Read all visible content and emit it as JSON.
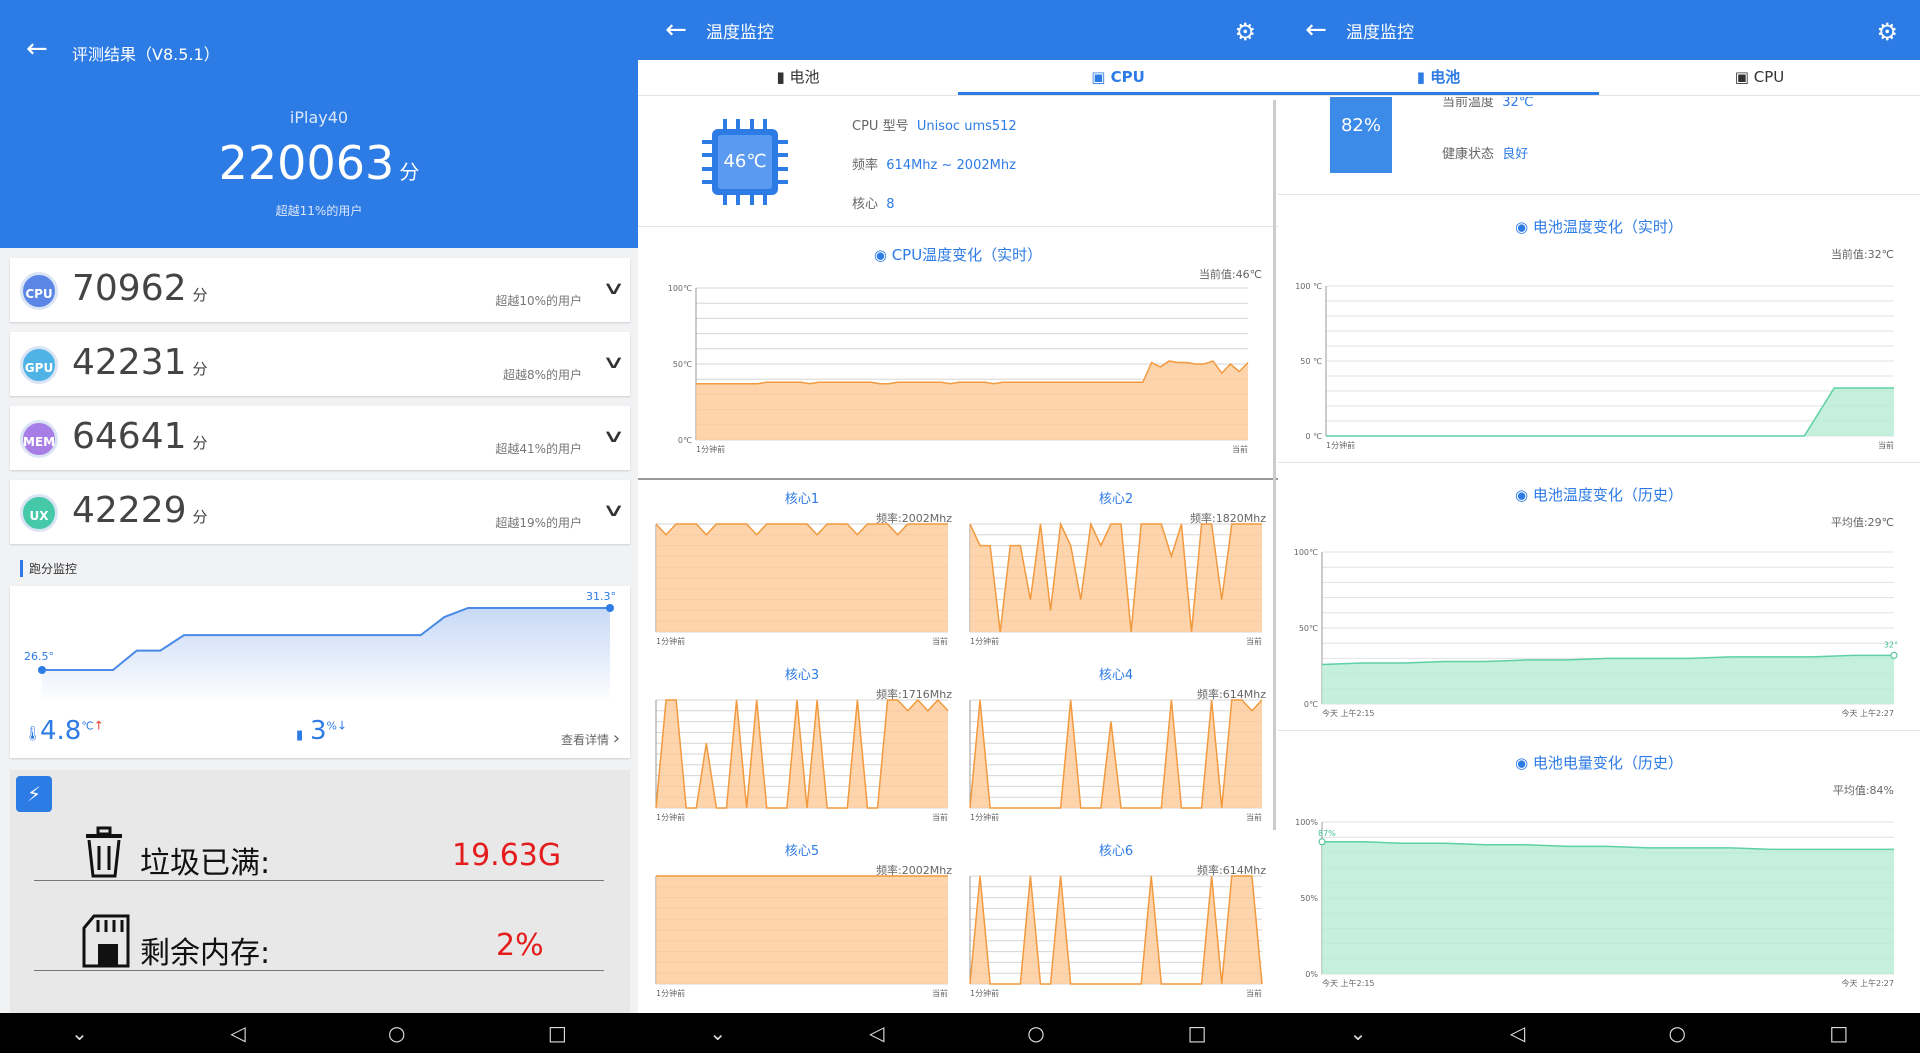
{
  "p1": {
    "title": "评测结果（V8.5.1）",
    "device": "iPlay40",
    "score": "220063",
    "unit": "分",
    "beat": "超越11%的用户",
    "items": [
      {
        "badge": "CPU",
        "score": "70962",
        "unit": "分",
        "beat": "超越10%的用户",
        "color": "#5b86e5"
      },
      {
        "badge": "GPU",
        "score": "42231",
        "unit": "分",
        "beat": "超越8%的用户",
        "color": "#4fb3e5"
      },
      {
        "badge": "MEM",
        "score": "64641",
        "unit": "分",
        "beat": "超越41%的用户",
        "color": "#a77ee6"
      },
      {
        "badge": "UX",
        "score": "42229",
        "unit": "分",
        "beat": "超越19%的用户",
        "color": "#46c9a8"
      }
    ],
    "monitor_label": "跑分监控",
    "temp_start": "26.5°",
    "temp_end": "31.3°",
    "temp_delta": "4.8",
    "temp_unit": "℃",
    "batt_delta": "3",
    "batt_unit": "%",
    "details": "查看详情",
    "trash_label": "垃圾已满:",
    "trash_value": "19.63G",
    "mem_label": "剩余内存:",
    "mem_value": "2%",
    "temp_series": [
      26.5,
      26.5,
      26.5,
      26.5,
      28.0,
      28.0,
      29.2,
      29.2,
      29.2,
      29.2,
      29.2,
      29.2,
      29.2,
      29.2,
      29.2,
      29.2,
      29.2,
      30.6,
      31.3,
      31.3,
      31.3,
      31.3,
      31.3,
      31.3,
      31.3
    ]
  },
  "p2": {
    "title": "温度监控",
    "tabs": [
      "电池",
      "CPU"
    ],
    "chip_temp": "46℃",
    "model_label": "CPU 型号",
    "model": "Unisoc ums512",
    "freq_label": "频率",
    "freq": "614Mhz ~ 2002Mhz",
    "cores_label": "核心",
    "cores": "8",
    "chart_title": "CPU温度变化（实时）",
    "current": "当前值:46℃",
    "yticks": [
      "100℃",
      "50℃",
      "0℃"
    ],
    "x_start": "1分钟前",
    "x_end": "当前",
    "cores_data": [
      {
        "name": "核心1",
        "freq": "频率:2002Mhz"
      },
      {
        "name": "核心2",
        "freq": "频率:1820Mhz"
      },
      {
        "name": "核心3",
        "freq": "频率:1716Mhz"
      },
      {
        "name": "核心4",
        "freq": "频率:614Mhz"
      },
      {
        "name": "核心5",
        "freq": "频率:2002Mhz"
      },
      {
        "name": "核心6",
        "freq": "频率:614Mhz"
      }
    ],
    "core_x_start": "1分钟前",
    "core_x_end": "当前"
  },
  "p3": {
    "title": "温度监控",
    "tabs": [
      "电池",
      "CPU"
    ],
    "level": "82%",
    "cur_temp_label": "当前温度",
    "cur_temp": "32℃",
    "health_label": "健康状态",
    "health": "良好",
    "c1_title": "电池温度变化（实时）",
    "c1_current": "当前值:32℃",
    "c1_yticks": [
      "100 ℃",
      "50 ℃",
      "0 ℃"
    ],
    "c1_x0": "1分钟前",
    "c1_x1": "当前",
    "c2_title": "电池温度变化（历史）",
    "c2_avg": "平均值:29℃",
    "c2_yticks": [
      "100℃",
      "50℃",
      "0℃"
    ],
    "c2_x0": "今天 上午2:15",
    "c2_x1": "今天 上午2:27",
    "c2_end": "32°",
    "c3_title": "电池电量变化（历史）",
    "c3_avg": "平均值:84%",
    "c3_yticks": [
      "100%",
      "50%",
      "0%"
    ],
    "c3_x0": "今天 上午2:15",
    "c3_x1": "今天 上午2:27",
    "c3_start": "87%"
  },
  "chart_data": [
    {
      "type": "area",
      "title": "CPU温度变化（实时）",
      "ylim": [
        0,
        100
      ],
      "y": [
        37,
        37,
        37,
        37,
        37,
        37,
        37,
        37,
        38,
        38,
        38,
        38,
        38,
        37,
        38,
        38,
        38,
        38,
        38,
        38,
        38,
        37,
        37,
        38,
        38,
        38,
        38,
        38,
        38,
        37,
        38,
        38,
        38,
        38,
        37,
        38,
        38,
        38,
        38,
        38,
        38,
        38,
        38,
        38,
        38,
        38,
        38,
        38,
        38,
        38,
        38,
        38,
        51,
        48,
        52,
        51,
        51,
        50,
        50,
        52,
        44,
        50,
        45,
        51
      ]
    },
    {
      "type": "area",
      "title": "电池温度变化（实时）",
      "ylim": [
        0,
        100
      ],
      "y": [
        0,
        0,
        0,
        0,
        0,
        0,
        0,
        0,
        0,
        0,
        0,
        0,
        0,
        0,
        0,
        0,
        0,
        32,
        32,
        32
      ]
    },
    {
      "type": "area",
      "title": "电池温度变化（历史）",
      "ylim": [
        0,
        100
      ],
      "y": [
        26,
        27,
        27,
        28,
        28,
        29,
        29,
        30,
        30,
        30,
        31,
        31,
        31,
        32,
        32
      ]
    },
    {
      "type": "area",
      "title": "电池电量变化（历史）",
      "ylim": [
        0,
        100
      ],
      "y": [
        87,
        87,
        86,
        86,
        85,
        85,
        84,
        84,
        83,
        83,
        83,
        82,
        82,
        82,
        82
      ]
    }
  ]
}
